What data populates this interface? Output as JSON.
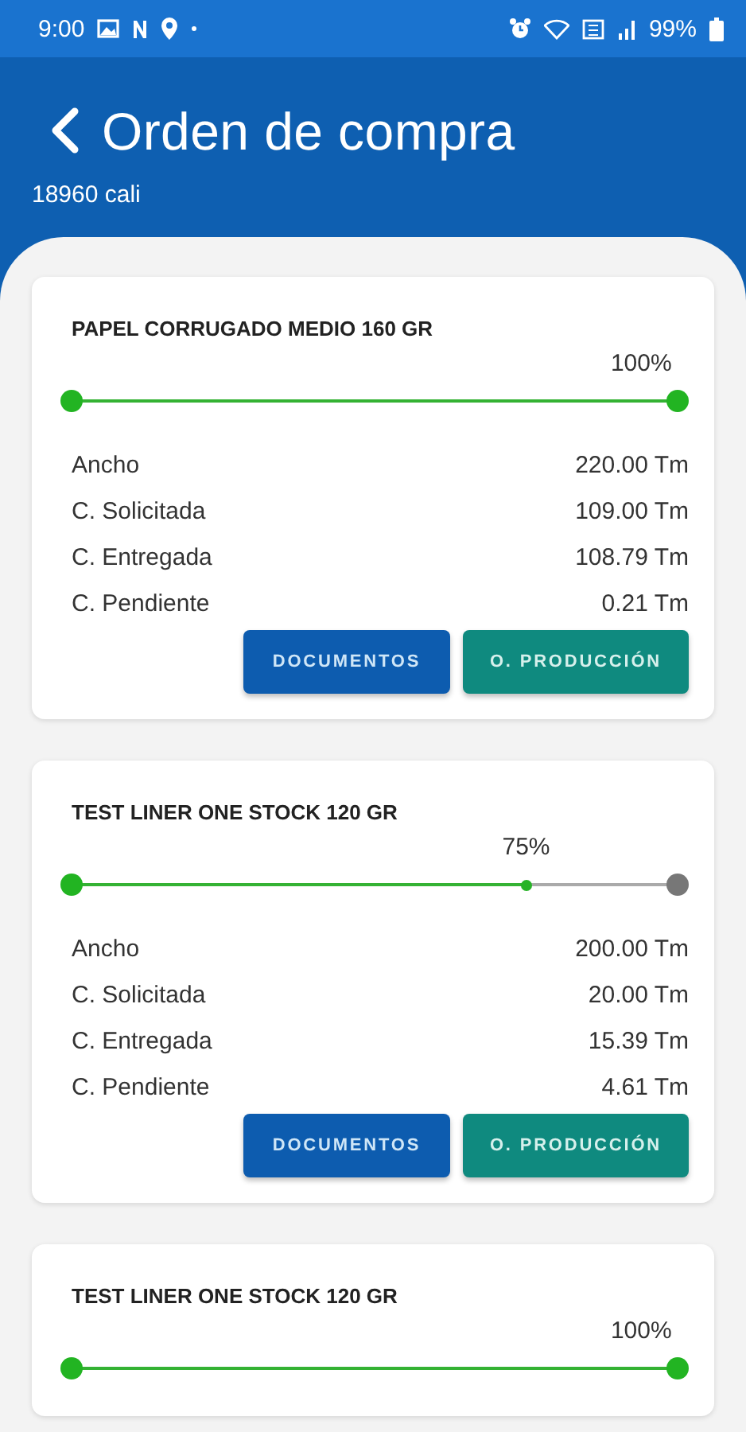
{
  "status_bar": {
    "time": "9:00",
    "battery": "99%"
  },
  "header": {
    "title": "Orden de compra",
    "subtitle": "18960 cali"
  },
  "orders": [
    {
      "title": "PAPEL CORRUGADO MEDIO 160 GR",
      "level": 1,
      "percent": "100%",
      "rows": [
        {
          "label": "Ancho",
          "value": "220.00 Tm"
        },
        {
          "label": "C. Solicitada",
          "value": "109.00 Tm"
        },
        {
          "label": "C. Entregada",
          "value": "108.79 Tm"
        },
        {
          "label": "C. Pendiente",
          "value": "0.21 Tm"
        }
      ],
      "buttons": [
        {
          "label": "DOCUMENTOS",
          "kind": "primary"
        },
        {
          "label": "O. PRODUCCIÓN",
          "kind": "secondary"
        }
      ]
    },
    {
      "title": "TEST LINER ONE STOCK 120 GR",
      "level": 0.75,
      "percent": "75%",
      "rows": [
        {
          "label": "Ancho",
          "value": "200.00 Tm"
        },
        {
          "label": "C. Solicitada",
          "value": "20.00 Tm"
        },
        {
          "label": "C. Entregada",
          "value": "15.39 Tm"
        },
        {
          "label": "C. Pendiente",
          "value": "4.61 Tm"
        }
      ],
      "buttons": [
        {
          "label": "DOCUMENTOS",
          "kind": "primary"
        },
        {
          "label": "O. PRODUCCIÓN",
          "kind": "secondary"
        }
      ]
    },
    {
      "title": "TEST LINER ONE STOCK 120 GR",
      "level": 1,
      "percent": "100%"
    }
  ]
}
